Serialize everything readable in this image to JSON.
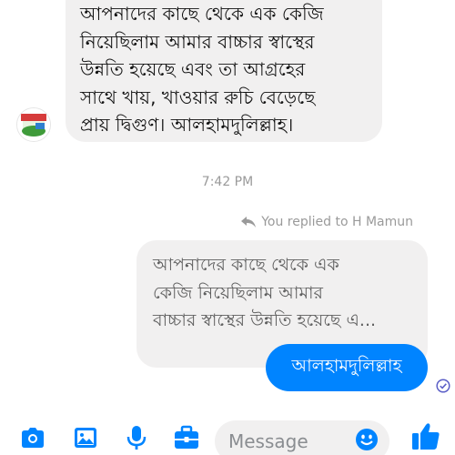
{
  "conversation": {
    "incoming_message": {
      "text": "আপনাদের কাছে থেকে এক কেজি\nনিয়েছিলাম আমার বাচ্চার স্বাস্থের\nউন্নতি হয়েছে এবং তা আগ্রহের\nসাথে খায়, খাওয়ার রুচি বেড়েছে\nপ্রায় দ্বিগুণ। আলহামদুলিল্লাহ।"
    },
    "timestamp": "7:42 PM",
    "reply_indicator": "You replied to H Mamun",
    "quoted_message": {
      "text": "আপনাদের কাছে থেকে এক\nকেজি নিয়েছিলাম আমার\nবাচ্চার স্বাস্থের উন্নতি হয়েছে এ..."
    },
    "outgoing_message": {
      "text": "আলহামদুলিল্লাহ"
    }
  },
  "composer": {
    "placeholder": "Message"
  },
  "colors": {
    "accent": "#0084ff",
    "bubble_gray": "#f1f0f0",
    "meta_text": "#9a9a9a"
  },
  "icons": {
    "camera": "camera-icon",
    "gallery": "image-icon",
    "voice": "microphone-icon",
    "more": "briefcase-icon",
    "emoji": "emoji-icon",
    "like": "thumbs-up-icon",
    "reply": "reply-arrow-icon",
    "seen": "seen-check-icon"
  }
}
